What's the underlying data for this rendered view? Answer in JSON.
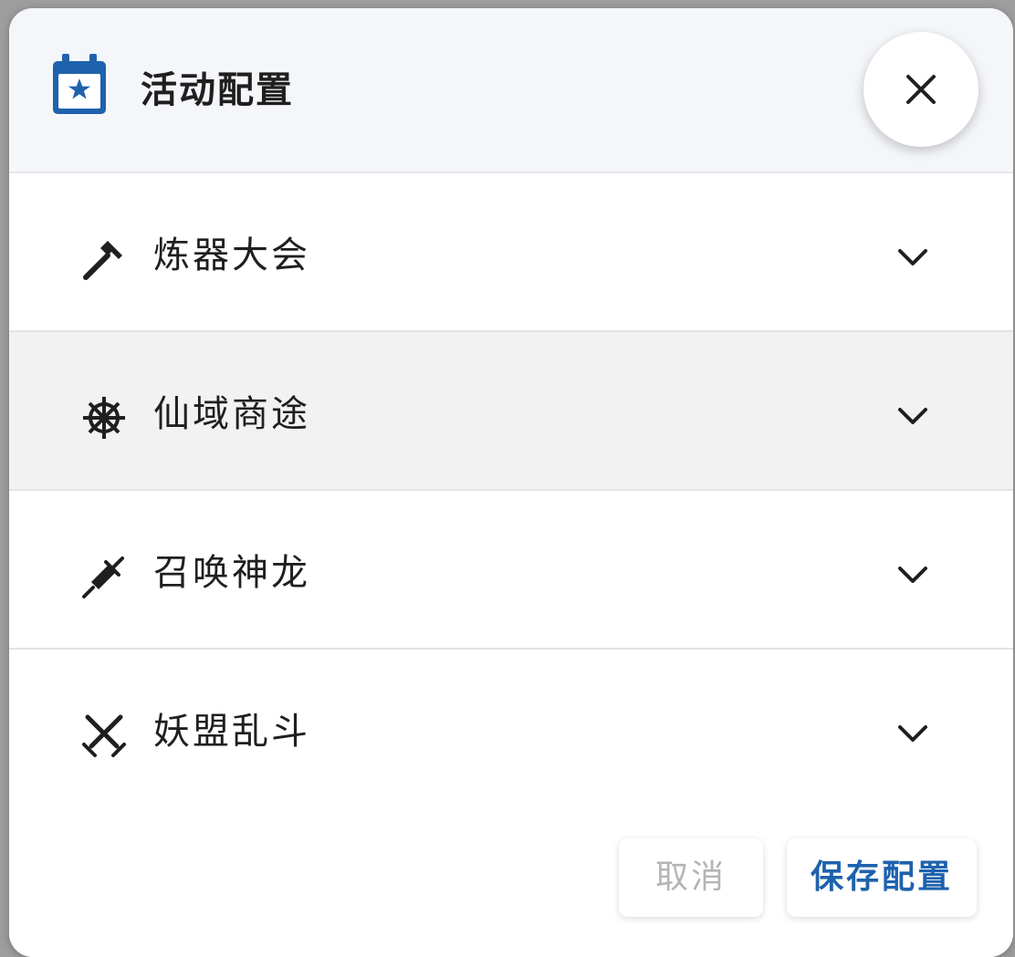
{
  "dialog": {
    "title": "活动配置",
    "title_icon": "calendar-star-icon",
    "close_icon": "close-icon",
    "accent_color": "#1e62ad"
  },
  "sections": [
    {
      "label": "炼器大会",
      "icon": "hammer-icon",
      "expanded": false
    },
    {
      "label": "仙域商途",
      "icon": "ship-wheel-icon",
      "expanded": false
    },
    {
      "label": "召唤神龙",
      "icon": "syringe-icon",
      "expanded": false
    },
    {
      "label": "妖盟乱斗",
      "icon": "crossed-swords-icon",
      "expanded": false
    }
  ],
  "footer": {
    "cancel_label": "取消",
    "save_label": "保存配置"
  }
}
